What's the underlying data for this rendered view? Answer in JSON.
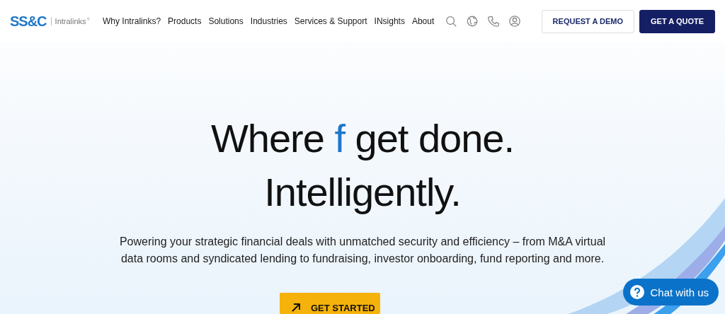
{
  "header": {
    "logo": {
      "mark": "SS&C",
      "product": "Intralinks",
      "trademark": "®"
    },
    "nav": [
      "Why Intralinks?",
      "Products",
      "Solutions",
      "Industries",
      "Services & Support",
      "INsights",
      "About"
    ],
    "icons": [
      {
        "kind": "search"
      },
      {
        "kind": "globe"
      },
      {
        "kind": "phone"
      },
      {
        "kind": "user"
      }
    ],
    "buttons": [
      {
        "label": "REQUEST A DEMO",
        "kind": "outline"
      },
      {
        "label": "GET A QUOTE",
        "kind": "solid"
      }
    ]
  },
  "hero": {
    "headline": [
      {
        "text": "Where ",
        "accent": false
      },
      {
        "text": "f",
        "accent": true
      },
      {
        "text": " get done.",
        "accent": false
      }
    ],
    "headline_2": "Intelligently.",
    "subtitle": "Powering your strategic financial deals with unmatched security and efficiency – from M&A virtual data rooms and syndicated lending to fundraising, investor onboarding, fund reporting and more.",
    "cta": "GET STARTED"
  },
  "chat": {
    "label": "Chat with us"
  }
}
